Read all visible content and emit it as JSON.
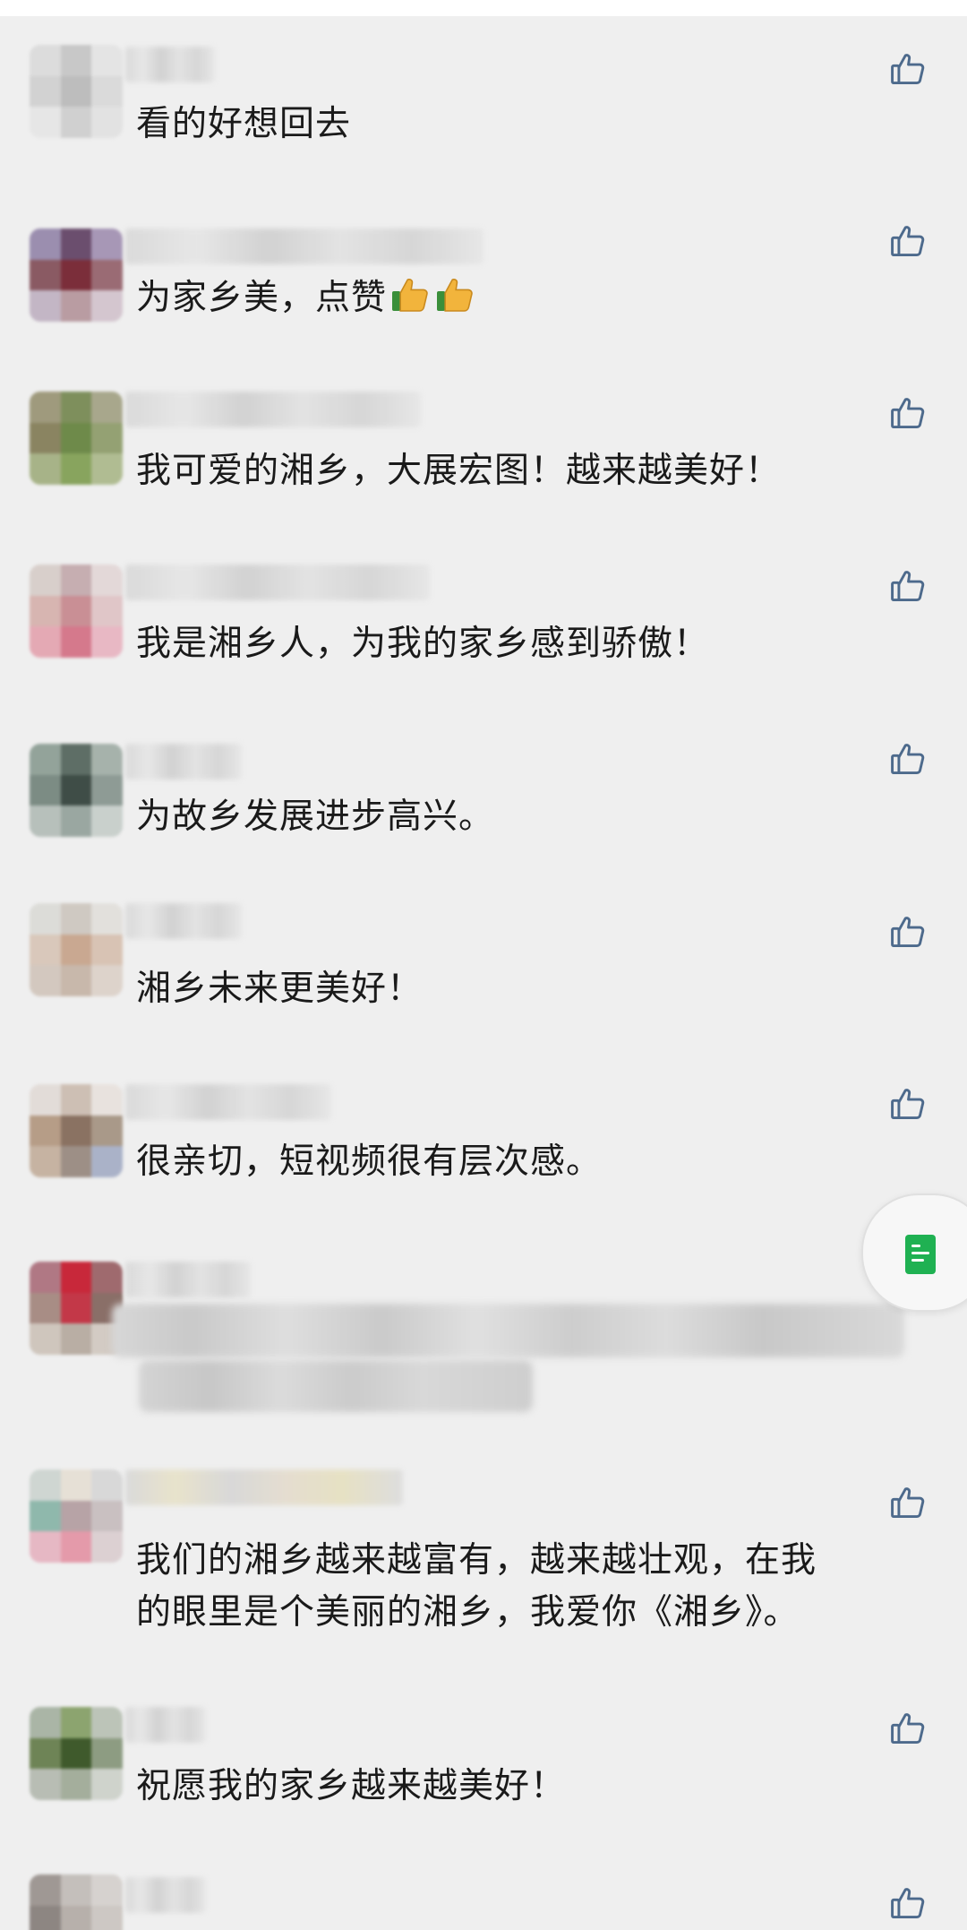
{
  "comments": [
    {
      "text": "看的好想回去"
    },
    {
      "text": "为家乡美，点赞"
    },
    {
      "text": "我可爱的湘乡，大展宏图！越来越美好！"
    },
    {
      "text": "我是湘乡人，为我的家乡感到骄傲！"
    },
    {
      "text": "为故乡发展进步高兴。"
    },
    {
      "text": "湘乡未来更美好！"
    },
    {
      "text": "很亲切，短视频很有层次感。"
    },
    {
      "text": "我们的湘乡越来越富有，越来越壮观，在我\n的眼里是个美丽的湘乡，我爱你《湘乡》。"
    },
    {
      "text": "祝愿我的家乡越来越美好！"
    }
  ],
  "icons": {
    "like": "thumbs-up-outline-icon",
    "emoji": "thumbs-up-emoji-icon",
    "floating_button": "document-icon"
  },
  "colors": {
    "background": "#efefef",
    "text": "#1a1a1a",
    "like_icon": "#4d6a8c",
    "floating_doc": "#1fb152"
  }
}
